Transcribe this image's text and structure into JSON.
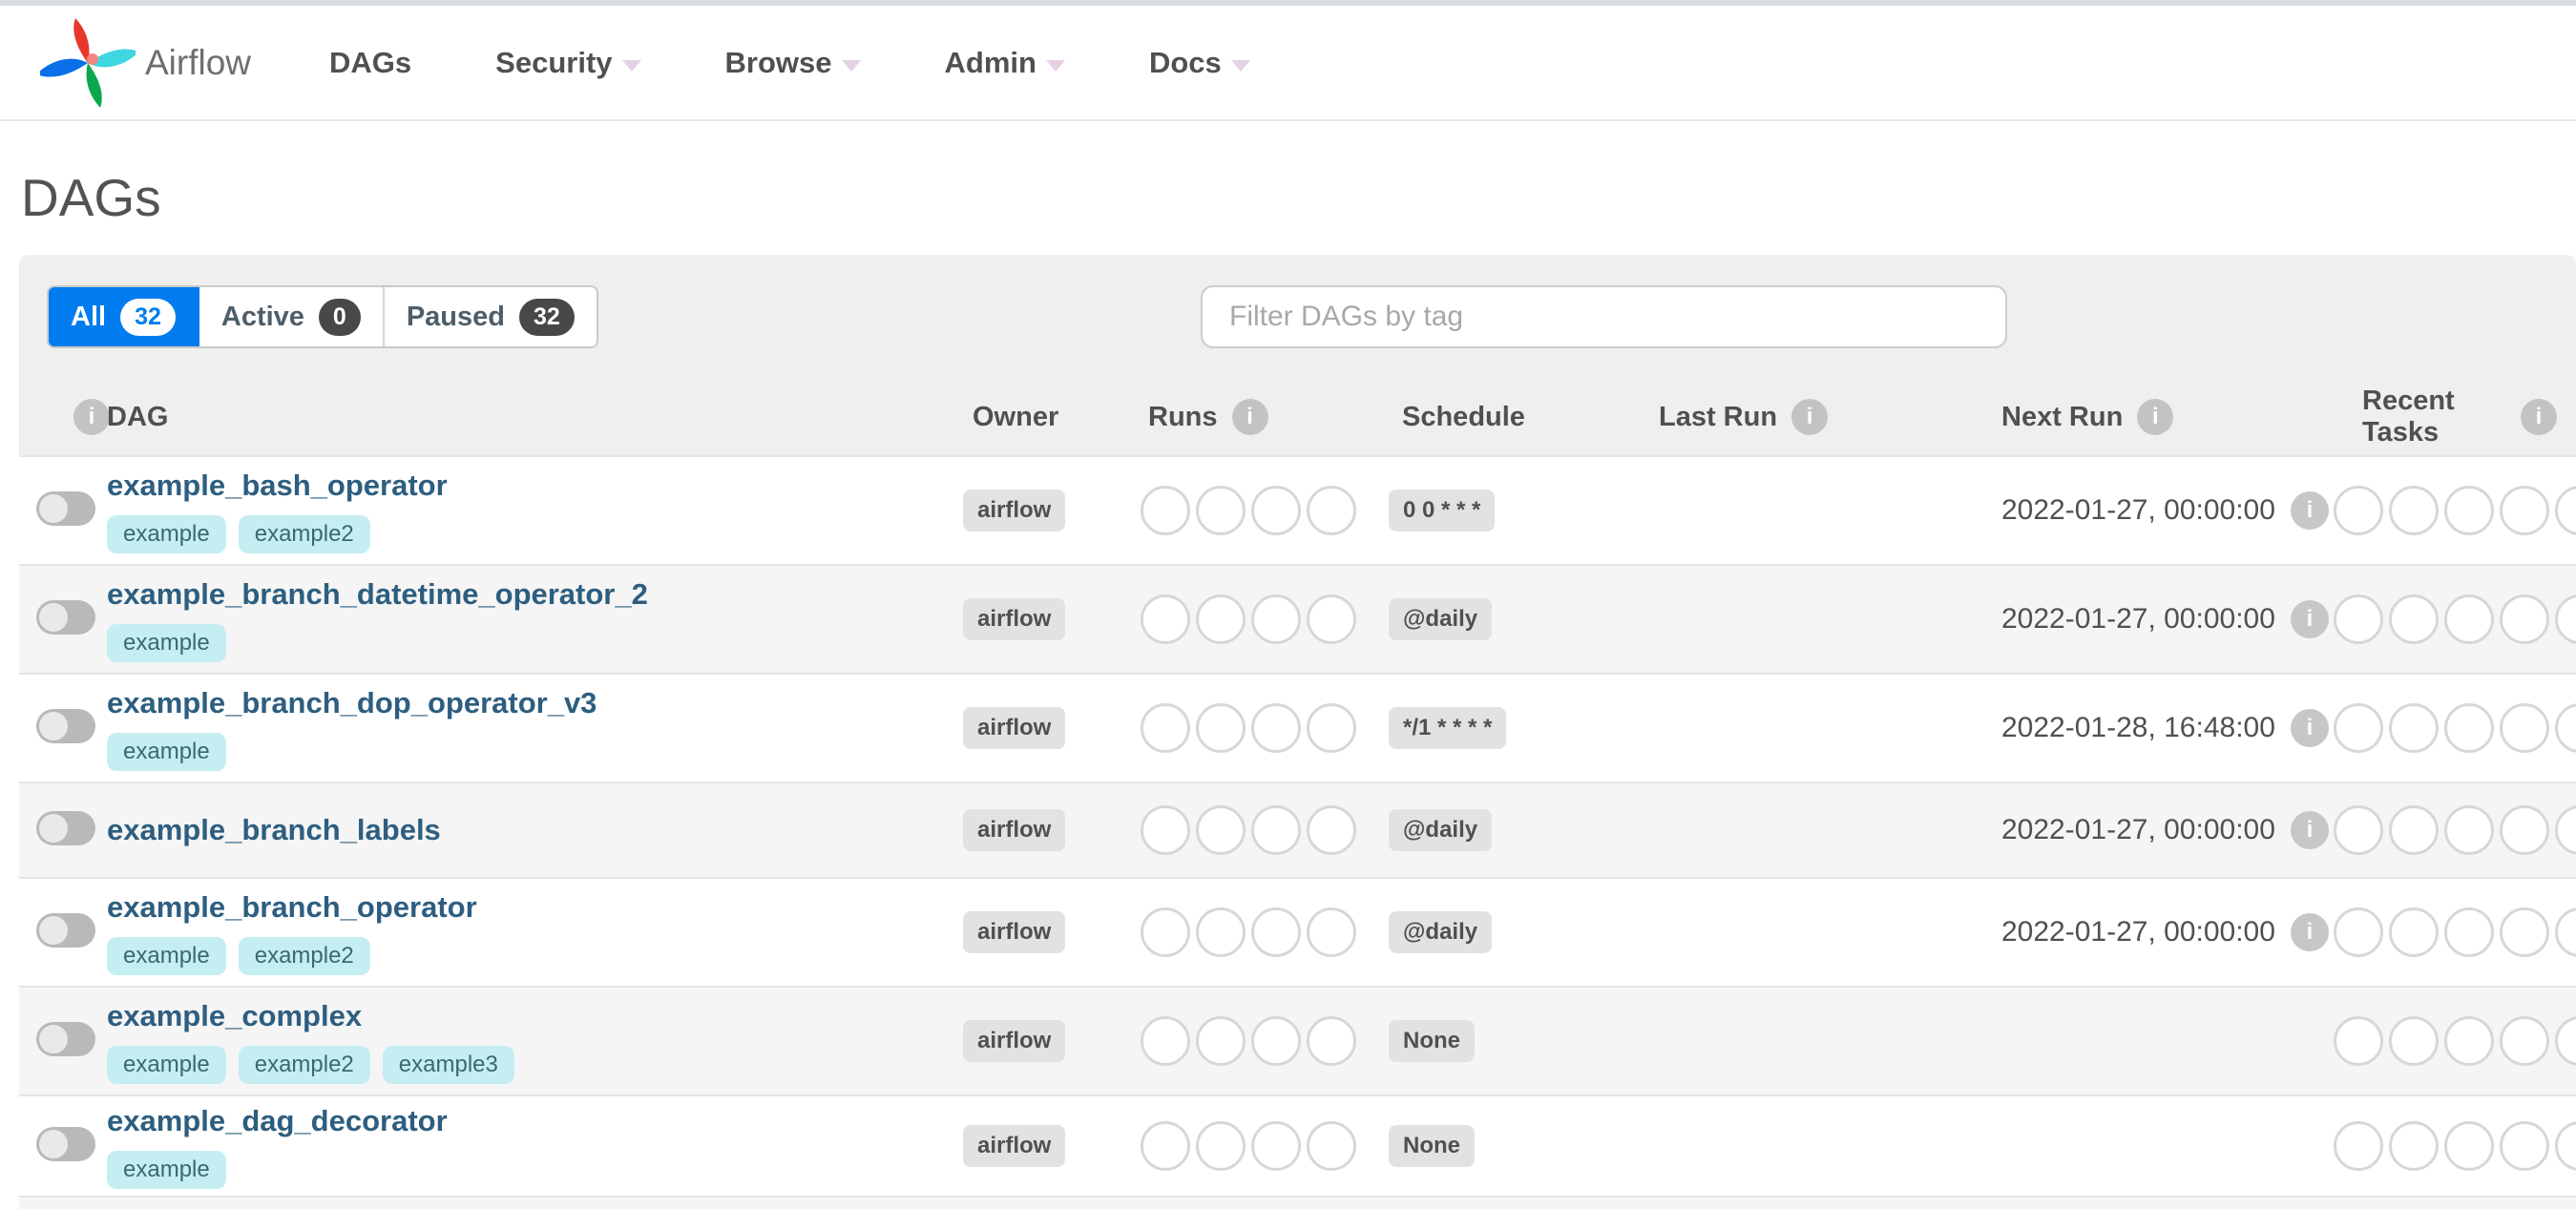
{
  "nav": {
    "brand": "Airflow",
    "items": [
      {
        "label": "DAGs",
        "dropdown": false
      },
      {
        "label": "Security",
        "dropdown": true
      },
      {
        "label": "Browse",
        "dropdown": true
      },
      {
        "label": "Admin",
        "dropdown": true
      },
      {
        "label": "Docs",
        "dropdown": true
      }
    ]
  },
  "page": {
    "title": "DAGs"
  },
  "toolbar": {
    "tabs": [
      {
        "label": "All",
        "count": "32",
        "active": true
      },
      {
        "label": "Active",
        "count": "0",
        "active": false
      },
      {
        "label": "Paused",
        "count": "32",
        "active": false
      }
    ],
    "filter_placeholder": "Filter DAGs by tag"
  },
  "table": {
    "headers": [
      {
        "label": "",
        "info": true
      },
      {
        "label": "DAG",
        "info": false
      },
      {
        "label": "Owner",
        "info": false
      },
      {
        "label": "Runs",
        "info": true
      },
      {
        "label": "Schedule",
        "info": false
      },
      {
        "label": "Last Run",
        "info": true
      },
      {
        "label": "Next Run",
        "info": true
      },
      {
        "label": "Recent Tasks",
        "info": true
      }
    ],
    "runs_slots": 4,
    "recent_slots": 5,
    "rows": [
      {
        "name": "example_bash_operator",
        "tags": [
          "example",
          "example2"
        ],
        "owner": "airflow",
        "schedule": "0 0 * * *",
        "last_run": "",
        "next_run": "2022-01-27, 00:00:00",
        "paused": true
      },
      {
        "name": "example_branch_datetime_operator_2",
        "tags": [
          "example"
        ],
        "owner": "airflow",
        "schedule": "@daily",
        "last_run": "",
        "next_run": "2022-01-27, 00:00:00",
        "paused": true
      },
      {
        "name": "example_branch_dop_operator_v3",
        "tags": [
          "example"
        ],
        "owner": "airflow",
        "schedule": "*/1 * * * *",
        "last_run": "",
        "next_run": "2022-01-28, 16:48:00",
        "paused": true
      },
      {
        "name": "example_branch_labels",
        "tags": [],
        "owner": "airflow",
        "schedule": "@daily",
        "last_run": "",
        "next_run": "2022-01-27, 00:00:00",
        "paused": true
      },
      {
        "name": "example_branch_operator",
        "tags": [
          "example",
          "example2"
        ],
        "owner": "airflow",
        "schedule": "@daily",
        "last_run": "",
        "next_run": "2022-01-27, 00:00:00",
        "paused": true
      },
      {
        "name": "example_complex",
        "tags": [
          "example",
          "example2",
          "example3"
        ],
        "owner": "airflow",
        "schedule": "None",
        "last_run": "",
        "next_run": "",
        "paused": true
      },
      {
        "name": "example_dag_decorator",
        "tags": [
          "example"
        ],
        "owner": "airflow",
        "schedule": "None",
        "last_run": "",
        "next_run": "",
        "paused": true
      }
    ]
  },
  "colors": {
    "accent_blue": "#017cee",
    "count_badge_dark": "#484848",
    "tag_background": "#c5eef2",
    "tag_text": "#3b6872",
    "dag_link": "#2d5e80",
    "gray_badge": "#e2e2e2",
    "text_primary": "#51504f",
    "logo_red": "#e6372d",
    "logo_teal": "#3ed6e0",
    "logo_green": "#0aa84e",
    "logo_blue": "#0a6fe8"
  }
}
